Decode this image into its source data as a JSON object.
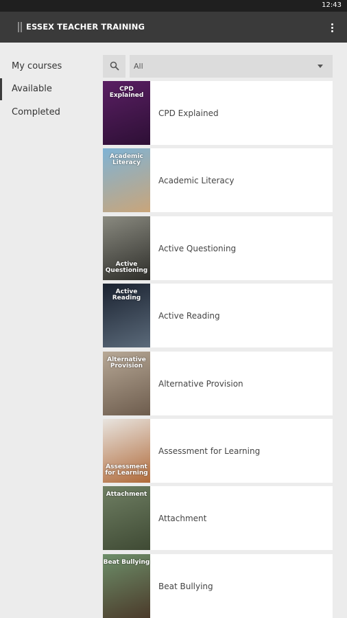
{
  "status_bar": {
    "time": "12:43"
  },
  "app_bar": {
    "title": "ESSEX TEACHER TRAINING",
    "menu_icon": "more-vert-icon"
  },
  "sidebar": {
    "items": [
      {
        "label": "My courses",
        "active": false
      },
      {
        "label": "Available",
        "active": true
      },
      {
        "label": "Completed",
        "active": false
      }
    ]
  },
  "filter": {
    "search_icon": "search-icon",
    "selected": "All"
  },
  "courses": [
    {
      "title": "CPD Explained",
      "thumb_text": "CPD Explained",
      "thumb_colors": [
        "#5a1f63",
        "#2d0f35"
      ]
    },
    {
      "title": "Academic Literacy",
      "thumb_text": "Academic Literacy",
      "thumb_colors": [
        "#7fb3d5",
        "#c9a57a"
      ]
    },
    {
      "title": "Active Questioning",
      "thumb_text": "Active Questioning",
      "thumb_colors": [
        "#8a8a80",
        "#2e2e2a"
      ]
    },
    {
      "title": "Active Reading",
      "thumb_text": "Active Reading",
      "thumb_colors": [
        "#1a2230",
        "#5b6a7a"
      ]
    },
    {
      "title": "Alternative Provision",
      "thumb_text": "Alternative Provision",
      "thumb_colors": [
        "#b7a896",
        "#6d5c4d"
      ]
    },
    {
      "title": "Assessment for Learning",
      "thumb_text": "Assessment for Learning",
      "thumb_colors": [
        "#e8e4df",
        "#b06a3a"
      ]
    },
    {
      "title": "Attachment",
      "thumb_text": "Attachment",
      "thumb_colors": [
        "#6f7f63",
        "#3f4a34"
      ]
    },
    {
      "title": "Beat Bullying",
      "thumb_text": "Beat Bullying",
      "thumb_colors": [
        "#6d8f6a",
        "#4b3a2a"
      ]
    }
  ]
}
